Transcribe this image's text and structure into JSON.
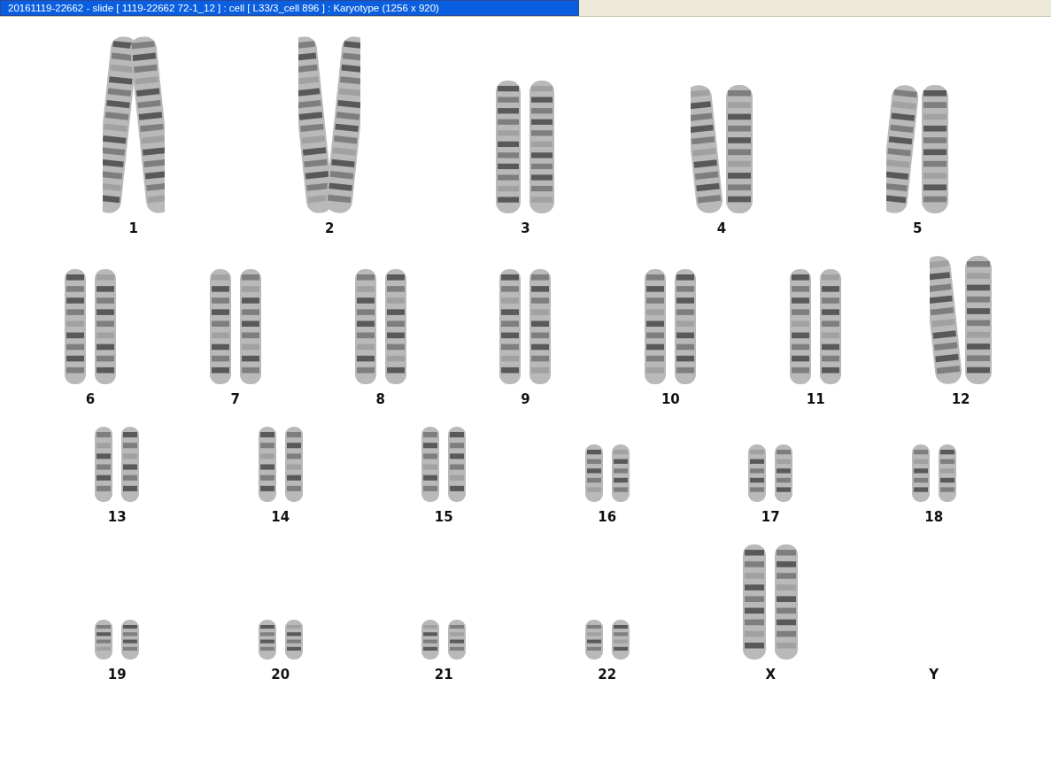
{
  "window": {
    "title": "20161119-22662 - slide [ 1119-22662 72-1_12 ] : cell [ L33/3_cell 896 ] : Karyotype  (1256 x 920)"
  },
  "rows": [
    {
      "pairs": [
        {
          "label": "1",
          "kind": "large"
        },
        {
          "label": "2",
          "kind": "large"
        },
        {
          "label": "3",
          "kind": "large3"
        },
        {
          "label": "4",
          "kind": "bent"
        },
        {
          "label": "5",
          "kind": "bent"
        }
      ]
    },
    {
      "pairs": [
        {
          "label": "6",
          "kind": "medium"
        },
        {
          "label": "7",
          "kind": "medium"
        },
        {
          "label": "8",
          "kind": "medium"
        },
        {
          "label": "9",
          "kind": "medium"
        },
        {
          "label": "10",
          "kind": "medium"
        },
        {
          "label": "11",
          "kind": "medium"
        },
        {
          "label": "12",
          "kind": "bent"
        }
      ]
    },
    {
      "pairs": [
        {
          "label": "13",
          "kind": "small"
        },
        {
          "label": "14",
          "kind": "small"
        },
        {
          "label": "15",
          "kind": "small"
        },
        {
          "label": "16",
          "kind": "short"
        },
        {
          "label": "17",
          "kind": "short"
        },
        {
          "label": "18",
          "kind": "short"
        }
      ]
    },
    {
      "pairs": [
        {
          "label": "19",
          "kind": "tiny"
        },
        {
          "label": "20",
          "kind": "tiny"
        },
        {
          "label": "21",
          "kind": "tiny"
        },
        {
          "label": "22",
          "kind": "tiny"
        },
        {
          "label": "X",
          "kind": "sex"
        },
        {
          "label": "Y",
          "kind": "empty"
        }
      ]
    }
  ]
}
